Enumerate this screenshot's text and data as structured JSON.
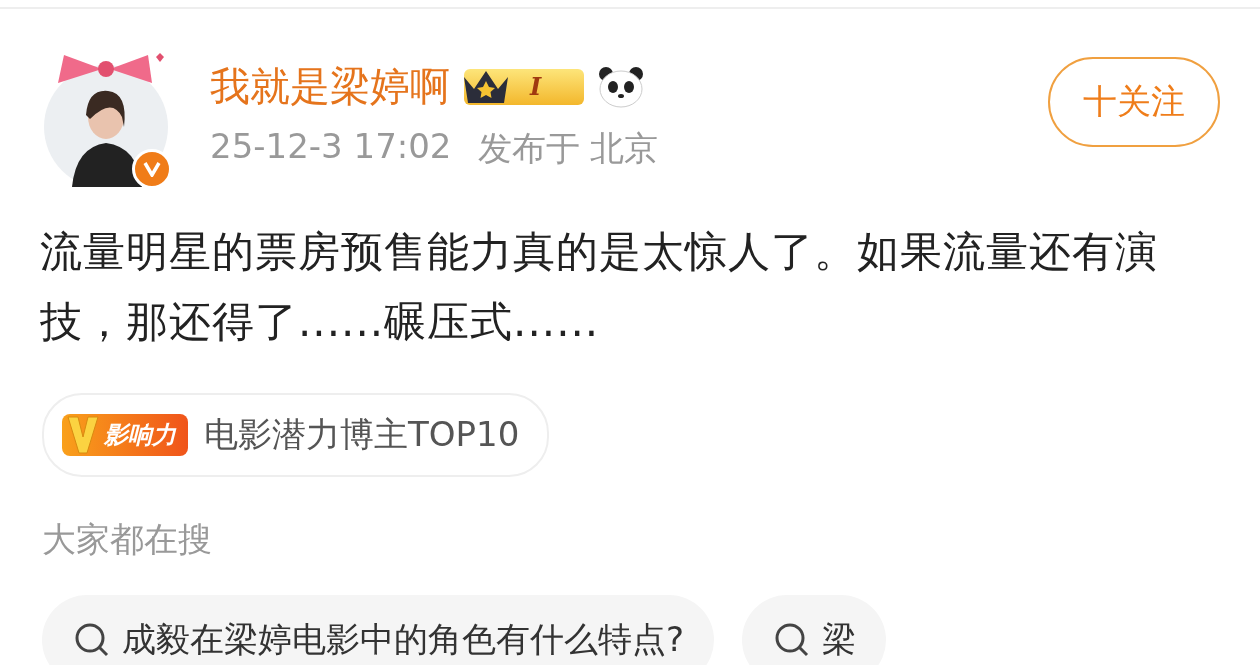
{
  "user": {
    "name": "我就是梁婷啊",
    "level_badge": "I",
    "verified": true,
    "time": "25-12-3 17:02",
    "location": "发布于 北京"
  },
  "follow_button": {
    "label": "十关注"
  },
  "post": {
    "text": "流量明星的票房预售能力真的是太惊人了。如果流量还有演技，那还得了......碾压式......"
  },
  "influence_tag": {
    "badge": "影响力",
    "label": "电影潜力博主TOP10"
  },
  "search_section": {
    "title": "大家都在搜",
    "items": [
      {
        "label": "成毅在梁婷电影中的角色有什么特点?"
      },
      {
        "label": "梁"
      }
    ]
  }
}
